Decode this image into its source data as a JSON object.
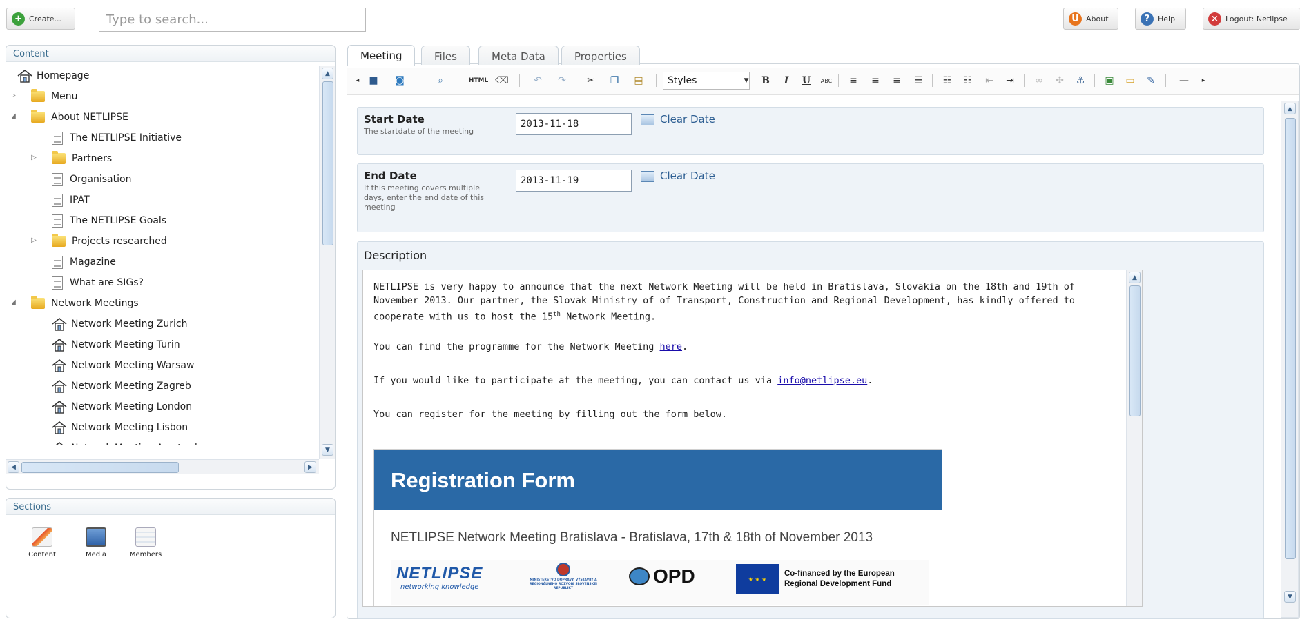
{
  "topbar": {
    "create_label": "Create...",
    "search_placeholder": "Type to search...",
    "about_label": "About",
    "help_label": "Help",
    "logout_label": "Logout: Netlipse"
  },
  "content_panel": {
    "title": "Content",
    "tree": [
      {
        "label": "Homepage",
        "icon": "house-icon",
        "arrow": "",
        "indent": 0
      },
      {
        "label": "Menu",
        "icon": "folder-icon",
        "arrow": "collapsed",
        "indent": 1
      },
      {
        "label": "About NETLIPSE",
        "icon": "folder-icon",
        "arrow": "expanded",
        "indent": 1
      },
      {
        "label": "The NETLIPSE Initiative",
        "icon": "document-icon",
        "arrow": "",
        "indent": 2
      },
      {
        "label": "Partners",
        "icon": "folder-icon",
        "arrow": "collapsed",
        "indent": 2
      },
      {
        "label": "Organisation",
        "icon": "document-icon",
        "arrow": "",
        "indent": 2
      },
      {
        "label": "IPAT",
        "icon": "document-icon",
        "arrow": "",
        "indent": 2
      },
      {
        "label": "The NETLIPSE Goals",
        "icon": "document-icon",
        "arrow": "",
        "indent": 2
      },
      {
        "label": "Projects researched",
        "icon": "folder-icon",
        "arrow": "collapsed",
        "indent": 2
      },
      {
        "label": "Magazine",
        "icon": "document-icon",
        "arrow": "",
        "indent": 2
      },
      {
        "label": "What are SIGs?",
        "icon": "document-icon",
        "arrow": "",
        "indent": 2
      },
      {
        "label": "Network Meetings",
        "icon": "folder-icon",
        "arrow": "expanded",
        "indent": 1
      },
      {
        "label": "Network Meeting Zurich",
        "icon": "house-icon",
        "arrow": "",
        "indent": 2
      },
      {
        "label": "Network Meeting Turin",
        "icon": "house-icon",
        "arrow": "",
        "indent": 2
      },
      {
        "label": "Network Meeting Warsaw",
        "icon": "house-icon",
        "arrow": "",
        "indent": 2
      },
      {
        "label": "Network Meeting Zagreb",
        "icon": "house-icon",
        "arrow": "",
        "indent": 2
      },
      {
        "label": "Network Meeting London",
        "icon": "house-icon",
        "arrow": "",
        "indent": 2
      },
      {
        "label": "Network Meeting Lisbon",
        "icon": "house-icon",
        "arrow": "",
        "indent": 2
      },
      {
        "label": "Network Meeting Amsterdam",
        "icon": "house-icon",
        "arrow": "",
        "indent": 2
      }
    ]
  },
  "sections_panel": {
    "title": "Sections",
    "items": [
      {
        "label": "Content",
        "icon": "content-section-icon"
      },
      {
        "label": "Media",
        "icon": "media-section-icon"
      },
      {
        "label": "Members",
        "icon": "members-section-icon"
      }
    ]
  },
  "tabs": [
    {
      "label": "Meeting",
      "active": true
    },
    {
      "label": "Files",
      "active": false
    },
    {
      "label": "Meta Data",
      "active": false
    },
    {
      "label": "Properties",
      "active": false
    }
  ],
  "toolbar": {
    "styles_label": "Styles",
    "html_label": "HTML",
    "icons": [
      "arrow-left-icon",
      "save-icon",
      "save-publish-icon",
      "preview-icon",
      "html-source-icon",
      "clean-icon",
      "undo-icon",
      "redo-icon",
      "cut-icon",
      "copy-icon",
      "paste-icon",
      "styles-dropdown",
      "bold-icon",
      "italic-icon",
      "underline-icon",
      "strikethrough-icon",
      "align-left-icon",
      "align-center-icon",
      "align-right-icon",
      "justify-icon",
      "bullet-list-icon",
      "numbered-list-icon",
      "outdent-icon",
      "indent-icon",
      "link-icon",
      "unlink-icon",
      "anchor-icon",
      "insert-image-icon",
      "insert-media-icon",
      "insert-macro-icon",
      "horizontal-rule-icon",
      "arrow-right-icon"
    ]
  },
  "properties": {
    "start_date": {
      "label": "Start Date",
      "description": "The startdate of the meeting",
      "value": "2013-11-18",
      "clear_label": "Clear Date"
    },
    "end_date": {
      "label": "End Date",
      "description": "If this meeting covers multiple days, enter the end date of this meeting",
      "value": "2013-11-19",
      "clear_label": "Clear Date"
    },
    "description": {
      "label": "Description"
    }
  },
  "editor": {
    "p1_a": "NETLIPSE is very happy to announce that the next Network Meeting will be held in Bratislava, Slovakia on the 18th and 19th of November 2013. Our partner, the Slovak Ministry of of Transport, Construction and Regional Development, has kindly offered to cooperate with us to host the 15",
    "p1_sup": "th",
    "p1_b": " Network Meeting.",
    "p2_a": "You can find the programme for the Network Meeting ",
    "p2_link": "here",
    "p2_b": ".",
    "p3_a": "If you would like to participate at the meeting, you can contact us via ",
    "p3_link": "info@netlipse.eu",
    "p3_b": ".",
    "p4": "You can register for the meeting by filling out the form below.",
    "reg_title": "Registration Form",
    "reg_subtitle": "NETLIPSE Network Meeting Bratislava - Bratislava, 17th & 18th of November 2013",
    "logo_netlipse": "NETLIPSE",
    "logo_netlipse_tag": "networking knowledge",
    "logo_ministry": "MINISTERSTVO DOPRAVY, VÝSTAVBY A REGIONÁLNEHO ROZVOJA SLOVENSKEJ REPUBLIKY",
    "logo_opd": "OPD",
    "logo_eu_text": "Co-financed by the European Regional Development Fund"
  },
  "colors": {
    "accent": "#2a69a6",
    "panel_header_text": "#3b6d8e",
    "link": "#2e5f93"
  }
}
